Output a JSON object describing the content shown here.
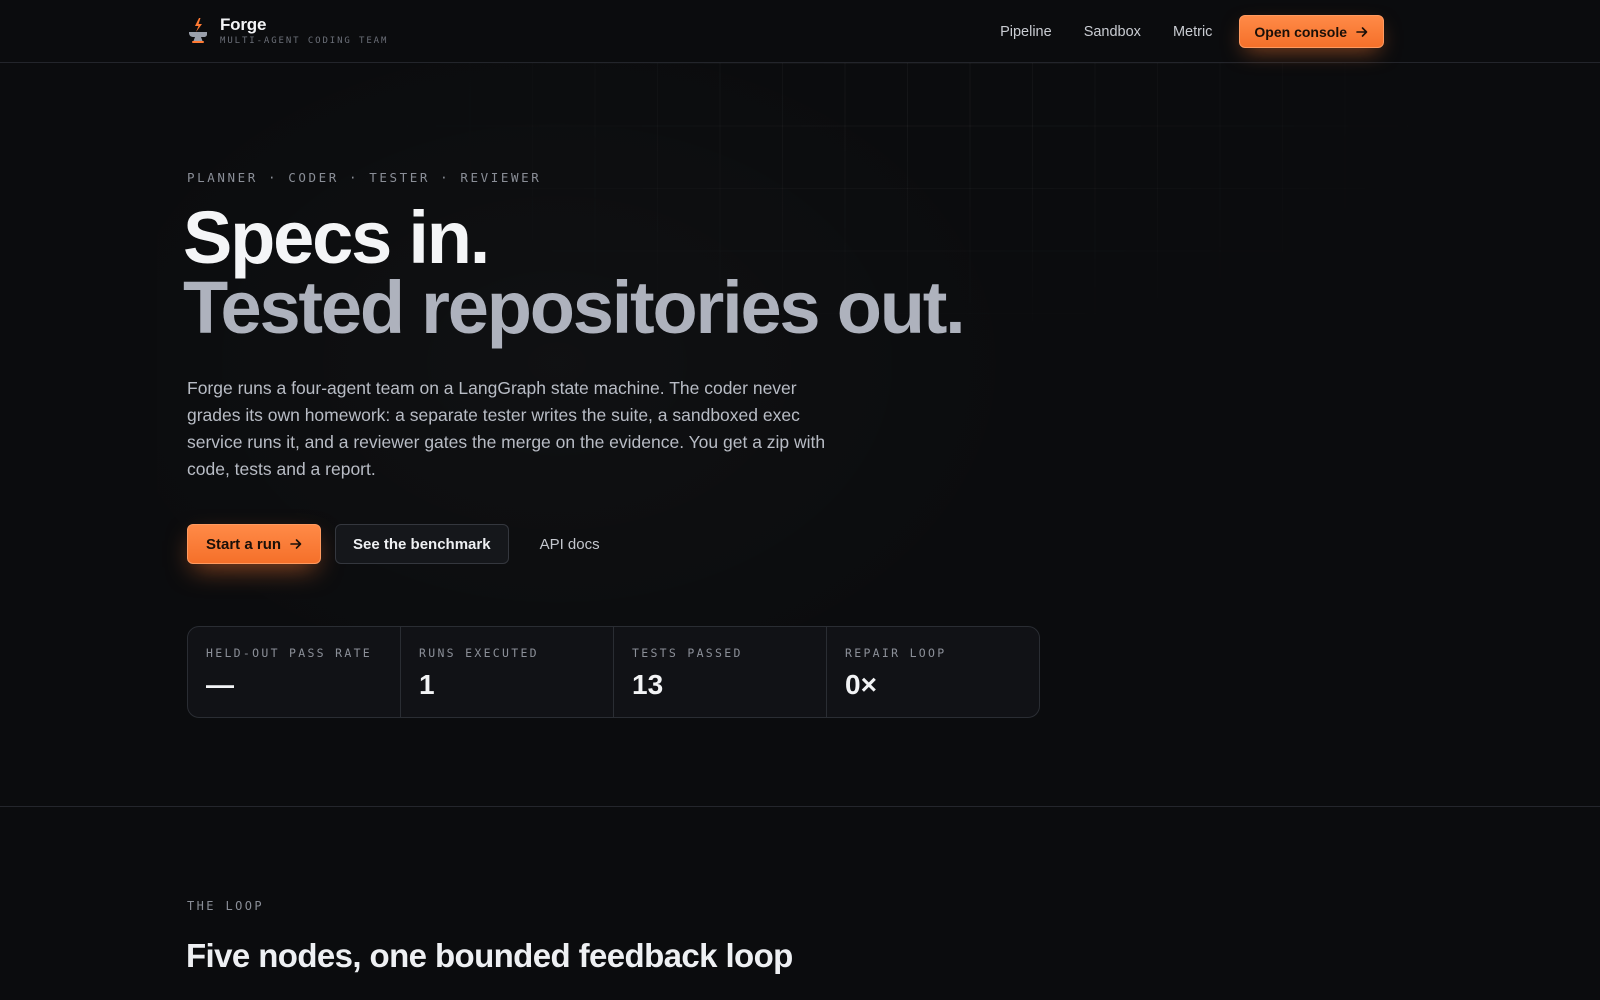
{
  "brand": {
    "name": "Forge",
    "tagline": "MULTI-AGENT CODING TEAM"
  },
  "nav": {
    "links": [
      "Pipeline",
      "Sandbox",
      "Metric"
    ],
    "console_button": "Open console"
  },
  "hero": {
    "eyebrow": "PLANNER · CODER · TESTER · REVIEWER",
    "headline_line1": "Specs in.",
    "headline_line2": "Tested repositories out.",
    "lede": "Forge runs a four-agent team on a LangGraph state machine. The coder never grades its own homework: a separate tester writes the suite, a sandboxed exec service runs it, and a reviewer gates the merge on the evidence. You get a zip with code, tests and a report.",
    "cta_primary": "Start a run",
    "cta_secondary": "See the benchmark",
    "cta_link": "API docs"
  },
  "stats": [
    {
      "label": "HELD-OUT PASS RATE",
      "value": "—"
    },
    {
      "label": "RUNS EXECUTED",
      "value": "1"
    },
    {
      "label": "TESTS PASSED",
      "value": "13"
    },
    {
      "label": "REPAIR LOOP",
      "value": "0×"
    }
  ],
  "loop": {
    "eyebrow": "THE LOOP",
    "title": "Five nodes, one bounded feedback loop"
  },
  "colors": {
    "accent": "#f5702a",
    "background": "#0b0c0e",
    "card": "#111216"
  },
  "icons": {
    "logo": "anvil-flame-icon",
    "arrow": "arrow-right-icon"
  }
}
